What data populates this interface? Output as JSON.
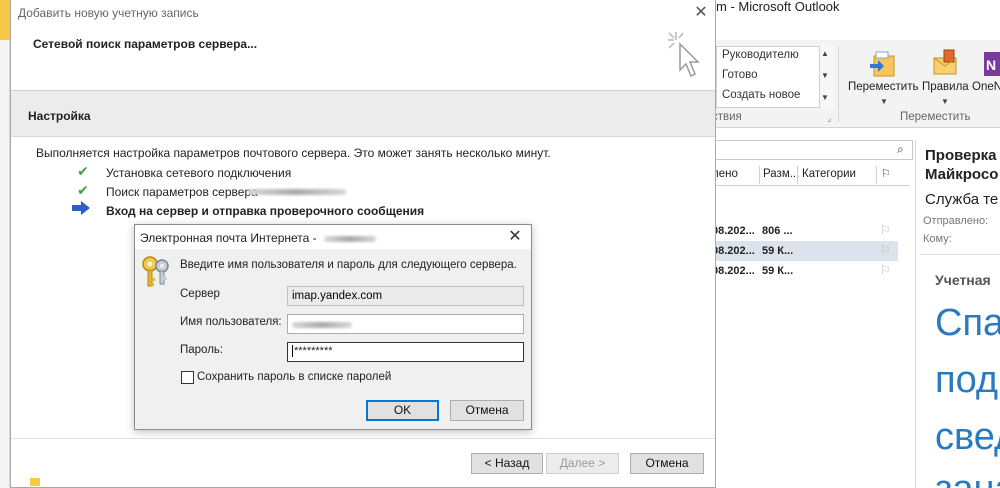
{
  "outlook": {
    "window_title": "m - Microsoft Outlook",
    "quick_steps": [
      "Руководителю",
      "Готово",
      "Создать новое"
    ],
    "quick_steps_group": "вствия",
    "move_label": "Переместить",
    "rules_label": "Правила",
    "onenote_label": "OneN",
    "move_group": "Переместить",
    "columns": [
      "лено",
      "Разм...",
      "Категории"
    ],
    "rows": [
      {
        "date": "08.202...",
        "size": "806 ..."
      },
      {
        "date": "08.202...",
        "size": "59 К..."
      },
      {
        "date": "08.202...",
        "size": "59 К..."
      }
    ],
    "reading": {
      "subject_line1": "Проверка",
      "subject_line2": "Майкросо",
      "sender": "Служба те",
      "sent_label": "Отправлено:",
      "to_label": "Кому:",
      "account_heading": "Учетная",
      "big_line1": "Спа",
      "big_line2": "под",
      "big_line3": "свед",
      "big_line4": "зана"
    }
  },
  "wizard": {
    "title": "Добавить новую учетную запись",
    "heading": "Сетевой поиск параметров сервера...",
    "section_title": "Настройка",
    "description": "Выполняется настройка параметров почтового сервера. Это может занять несколько минут.",
    "steps": [
      {
        "icon": "check",
        "text": "Установка сетевого подключения"
      },
      {
        "icon": "check",
        "text": "Поиск параметров сервера"
      },
      {
        "icon": "arrow",
        "text": "Вход на сервер и отправка проверочного сообщения"
      }
    ],
    "back_label": "< Назад",
    "next_label": "Далее >",
    "cancel_label": "Отмена",
    "close_glyph": "✕"
  },
  "credentials": {
    "title": "Электронная почта Интернета -",
    "prompt": "Введите имя пользователя и пароль для следующего сервера.",
    "server_label": "Сервер",
    "server_value": "imap.yandex.com",
    "username_label": "Имя пользователя:",
    "password_label": "Пароль:",
    "password_value": "*********",
    "save_label": "Сохранить пароль в списке паролей",
    "save_checked": false,
    "ok_label": "OK",
    "cancel_label": "Отмена",
    "close_glyph": "✕"
  },
  "colors": {
    "check": "#3fa33f",
    "arrow": "#2d5fc4",
    "focus": "#0078d7",
    "reading_blue": "#2a7ac0"
  }
}
